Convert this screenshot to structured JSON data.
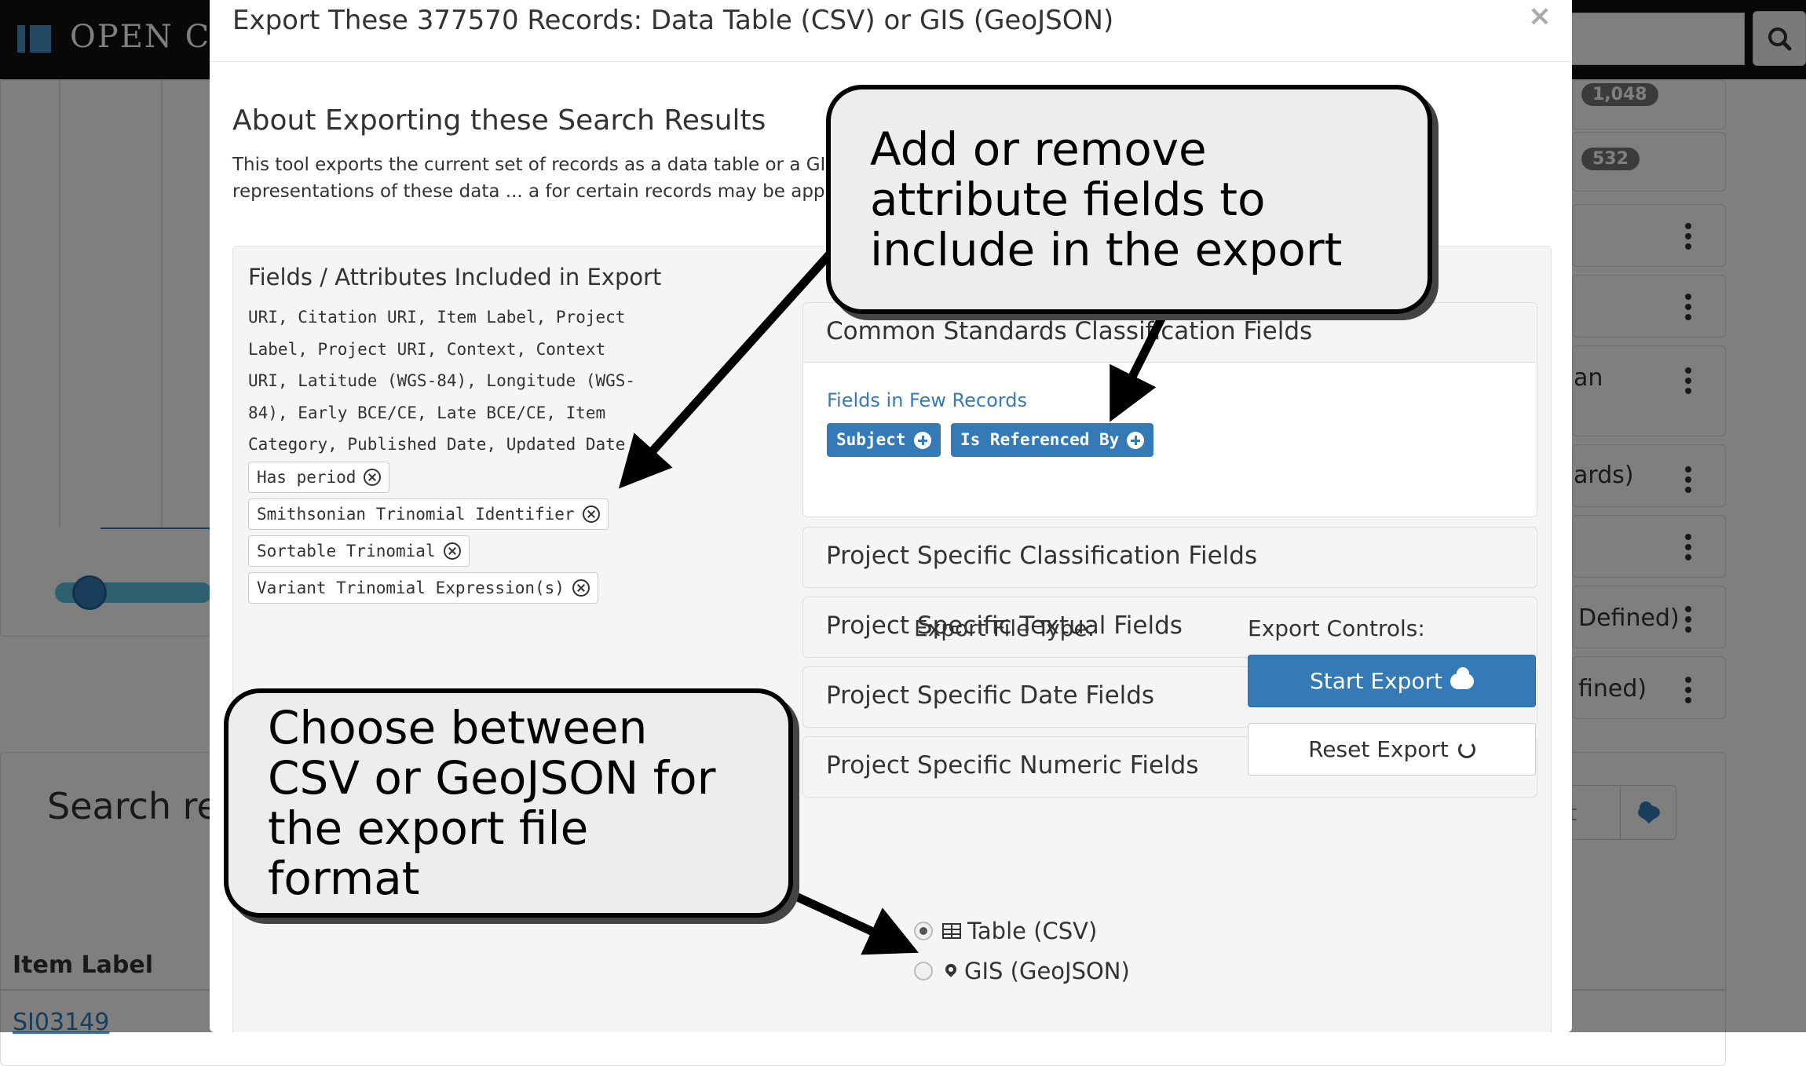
{
  "navbar": {
    "brand": "OPEN CONTEXT"
  },
  "background": {
    "badges": [
      "1,048",
      "532"
    ],
    "partial_labels": [
      "an",
      "ards)",
      "Defined)",
      "fined)"
    ],
    "search_heading": "Search results",
    "table_header_item_label": "Item Label",
    "first_item": "SI03149",
    "sort_button": "Sort"
  },
  "modal": {
    "title": "Export These 377570 Records: Data Table (CSV) or GIS (GeoJSON)",
    "close": "×",
    "about_heading": "About Exporting these Search Results",
    "about_text": "This tool exports the current set of records as a data table or a GIS output ... ed formats. If you need more expressive and complete representations of these data ... a for certain records may be approximated as a security precaution. The API provide",
    "fields_heading": "Fields / Attributes Included in Export",
    "fields_list": "URI, Citation URI, Item Label, Project Label, Project URI, Context, Context URI, Latitude (WGS-84), Longitude (WGS-84), Early BCE/CE, Late BCE/CE, Item Category, Published Date, Updated Date",
    "selected_fields": [
      "Has period",
      "Smithsonian Trinomial Identifier",
      "Sortable Trinomial",
      "Variant Trinomial Expression(s)"
    ],
    "accordion": {
      "common_heading": "Common Standards Classification Fields",
      "few_records_label": "Fields in Few Records",
      "add_fields": [
        "Subject",
        "Is Referenced By"
      ],
      "project_classification": "Project Specific Classification Fields",
      "project_textual": "Project Specific Textual Fields",
      "project_date": "Project Specific Date Fields",
      "project_numeric": "Project Specific Numeric Fields"
    },
    "export_type": {
      "label": "Export File Type:",
      "options": [
        "Table (CSV)",
        "GIS (GeoJSON)"
      ],
      "selected": "Table (CSV)"
    },
    "controls": {
      "label": "Export Controls:",
      "start": "Start Export",
      "reset": "Reset Export"
    }
  },
  "callouts": {
    "attributes": "Add or remove attribute fields to include in the export",
    "format": "Choose between CSV or GeoJSON for the export file format"
  },
  "colors": {
    "primary": "#337ab7",
    "navbar": "#111111",
    "badge": "#777777"
  }
}
